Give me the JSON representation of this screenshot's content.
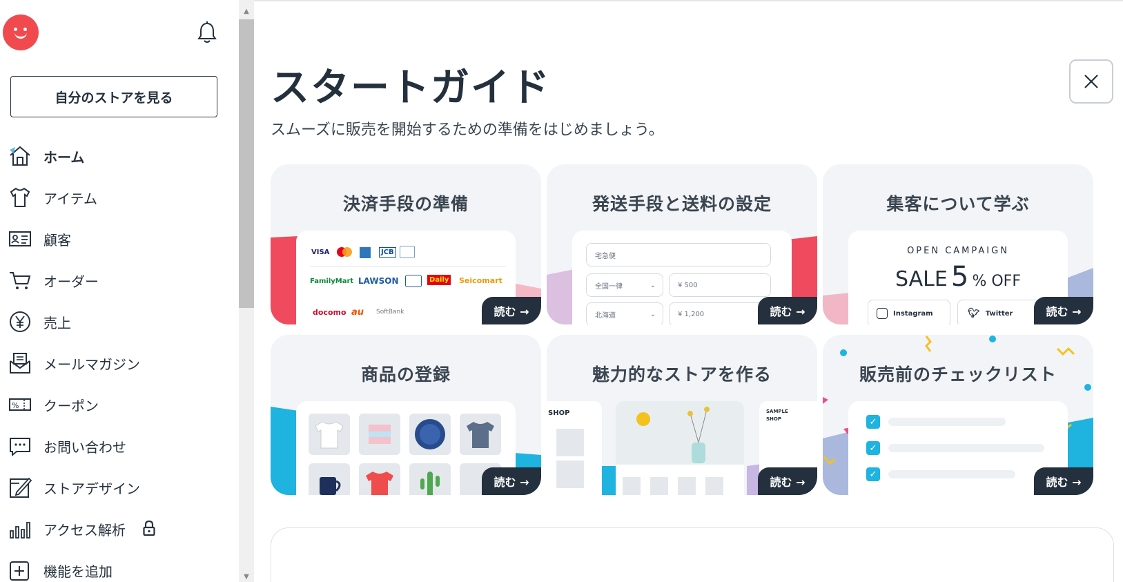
{
  "sidebar": {
    "view_store": "自分のストアを見る",
    "items": [
      {
        "label": "ホーム",
        "icon": "home-icon"
      },
      {
        "label": "アイテム",
        "icon": "shirt-icon"
      },
      {
        "label": "顧客",
        "icon": "id-card-icon"
      },
      {
        "label": "オーダー",
        "icon": "cart-icon"
      },
      {
        "label": "売上",
        "icon": "yen-icon"
      },
      {
        "label": "メールマガジン",
        "icon": "mail-icon"
      },
      {
        "label": "クーポン",
        "icon": "coupon-icon"
      },
      {
        "label": "お問い合わせ",
        "icon": "chat-icon"
      },
      {
        "label": "ストアデザイン",
        "icon": "design-icon"
      },
      {
        "label": "アクセス解析",
        "icon": "chart-icon"
      },
      {
        "label": "機能を追加",
        "icon": "plus-icon"
      }
    ]
  },
  "main": {
    "title": "スタートガイド",
    "subtitle": "スムーズに販売を開始するための準備をはじめましょう。",
    "read_label": "読む →",
    "cards": [
      {
        "title": "決済手段の準備"
      },
      {
        "title": "発送手段と送料の設定"
      },
      {
        "title": "集客について学ぶ"
      },
      {
        "title": "商品の登録"
      },
      {
        "title": "魅力的なストアを作る"
      },
      {
        "title": "販売前のチェックリスト"
      }
    ],
    "payment": {
      "cards": [
        "VISA",
        "JCB"
      ],
      "stores": [
        "FamilyMart",
        "LAWSON",
        "Daily",
        "Seicomart"
      ],
      "carriers": [
        "docomo",
        "au",
        "SoftBank"
      ]
    },
    "shipping": {
      "method_placeholder": "宅急便",
      "rows": [
        {
          "region": "全国一律",
          "price": "¥ 500"
        },
        {
          "region": "北海道",
          "price": "¥ 1,200"
        }
      ]
    },
    "campaign": {
      "heading": "OPEN CAMPAIGN",
      "sale_prefix": "SALE",
      "sale_number": "5",
      "sale_suffix": "% OFF",
      "instagram": "Instagram",
      "twitter": "Twitter"
    },
    "store_preview": {
      "shop_label": "SHOP",
      "sample_label": "SAMPLE SHOP"
    }
  },
  "colors": {
    "accent_red": "#f04a4f",
    "dark": "#24303d",
    "cyan": "#1fb3e0"
  }
}
